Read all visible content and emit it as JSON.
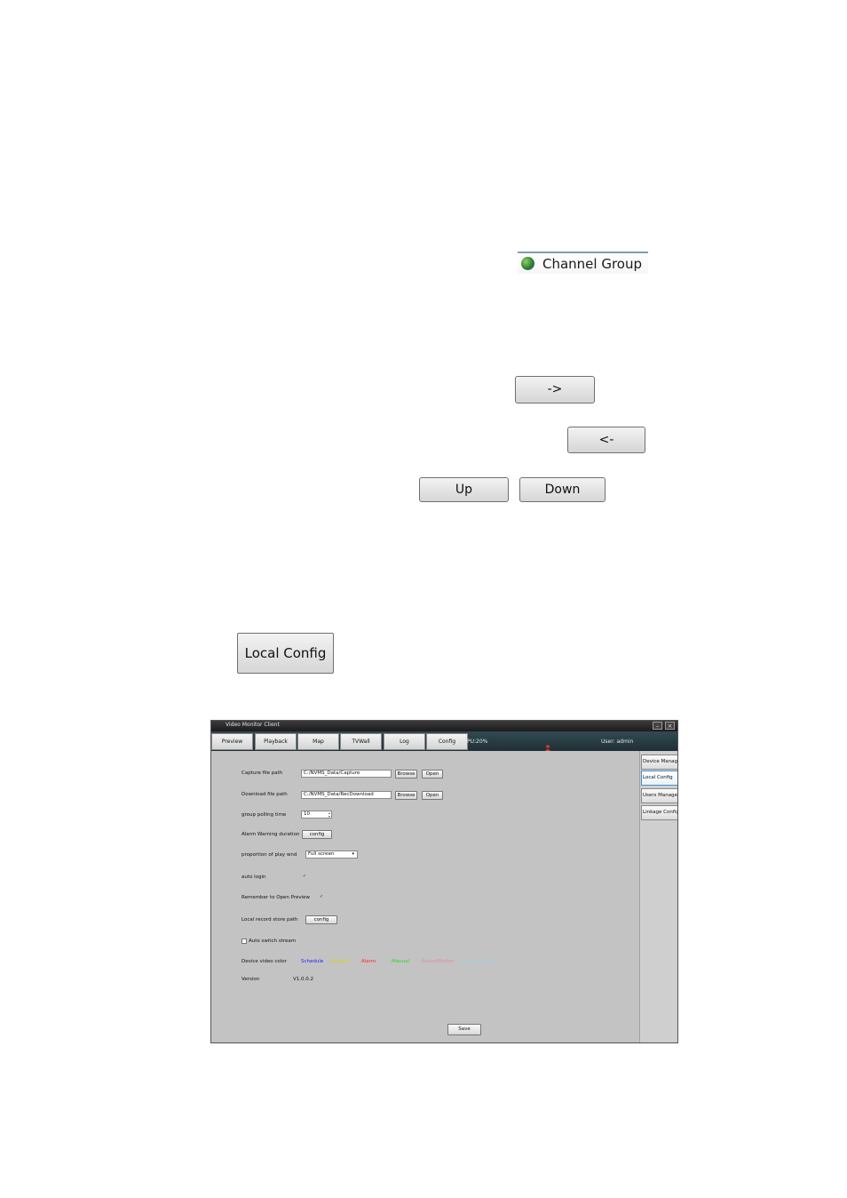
{
  "channel_group": {
    "label": "Channel Group",
    "icon": "globe-icon"
  },
  "buttons": {
    "move_right": "->",
    "move_left": "<-",
    "up": "Up",
    "down": "Down",
    "local_config": "Local Config"
  },
  "app": {
    "title": "Video Monitor Client",
    "window_buttons": {
      "minimize": "–",
      "close": "×"
    },
    "tabs": [
      "Preview",
      "Playback",
      "Map",
      "TVWall",
      "Log",
      "Config"
    ],
    "cpu": "PU:20%",
    "user": "User: admin",
    "side_menu": [
      "Device Manage",
      "Local Config",
      "Users Manage",
      "Linkage Config"
    ],
    "form": {
      "capture_label": "Capture file path",
      "capture_value": "C:/NVMS_Data/Capture",
      "download_label": "Download file path",
      "download_value": "C:/NVMS_Data/RecDownload",
      "browse": "Browse",
      "open": "Open",
      "polling_label": "group polling time",
      "polling_value": "10",
      "alarm_label": "Alarm Warning duration",
      "config": "config",
      "proportion_label": "proportion of play wnd",
      "proportion_value": "Full screen",
      "auto_login_label": "auto login",
      "remember_label": "Remember to  Open Preview",
      "record_path_label": "Local record store path",
      "auto_switch_label": "Auto switch stream",
      "color_label": "Device video color",
      "version_label": "Version",
      "version_value": "V1.0.0.2",
      "save": "Save"
    },
    "video_colors": [
      {
        "label": "Schedule",
        "color": "#1a1aff"
      },
      {
        "label": "Normal",
        "color": "#d8d800"
      },
      {
        "label": "Alarm",
        "color": "#ff2a1a"
      },
      {
        "label": "Manual",
        "color": "#22dd22"
      },
      {
        "label": "Alarm/Motion",
        "color": "#e88aa0"
      },
      {
        "label": "Alarm & Motion",
        "color": "#9ad0e8"
      }
    ]
  }
}
